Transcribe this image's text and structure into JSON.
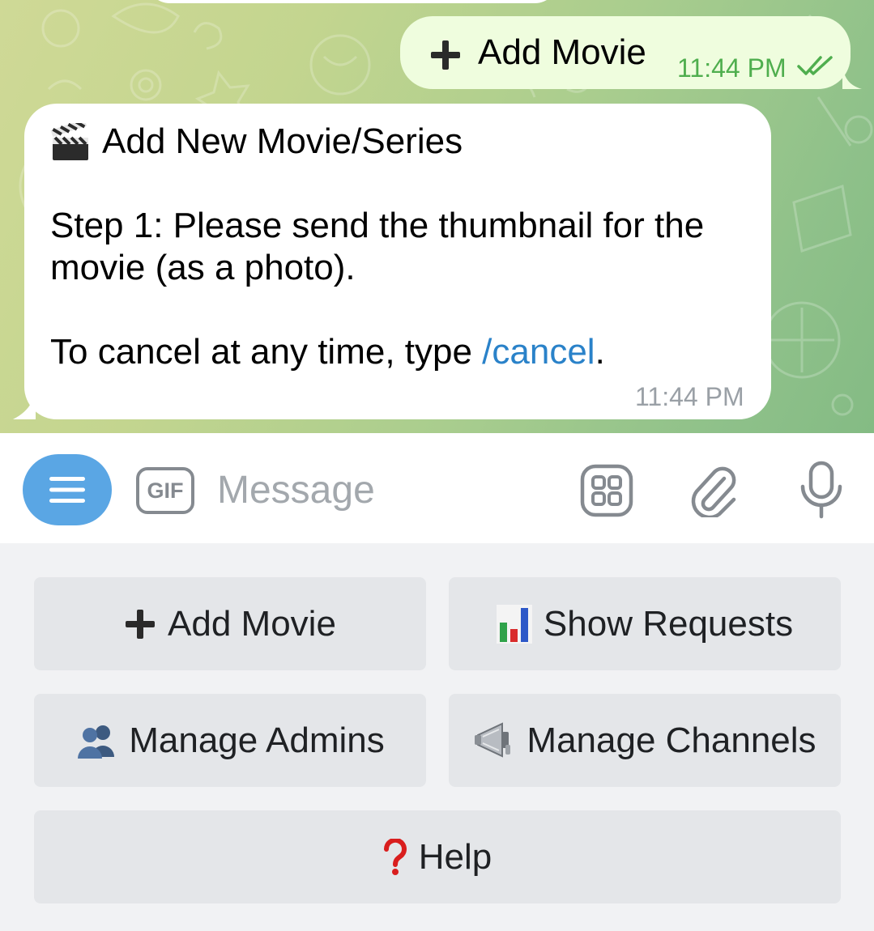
{
  "chat": {
    "outgoing": {
      "icon": "plus-icon",
      "text": "Add Movie",
      "time": "11:44 PM",
      "status": "read"
    },
    "incoming": {
      "icon": "clapper-board-icon",
      "title": "Add New Movie/Series",
      "step_line1": "Step 1: Please send the thumbnail for the",
      "step_line2": "movie (as a photo).",
      "cancel_prefix": "To cancel at any time, type ",
      "cancel_command": "/cancel",
      "cancel_suffix": ".",
      "time": "11:44 PM"
    }
  },
  "input_bar": {
    "menu_icon": "menu-icon",
    "gif_label": "GIF",
    "placeholder": "Message",
    "sticker_icon": "sticker-icon",
    "attach_icon": "paperclip-icon",
    "mic_icon": "microphone-icon"
  },
  "keyboard": {
    "buttons": [
      {
        "label": "Add Movie",
        "icon": "plus-icon"
      },
      {
        "label": "Show Requests",
        "icon": "bar-chart-icon"
      },
      {
        "label": "Manage Admins",
        "icon": "users-icon"
      },
      {
        "label": "Manage Channels",
        "icon": "megaphone-icon"
      },
      {
        "label": "Help",
        "icon": "question-mark-icon"
      }
    ]
  },
  "colors": {
    "accent": "#5aa6e4",
    "link": "#2a82c9",
    "outgoing_bubble": "#effdde",
    "outgoing_time": "#4fae4e",
    "keyboard_button": "#e4e6e9"
  }
}
